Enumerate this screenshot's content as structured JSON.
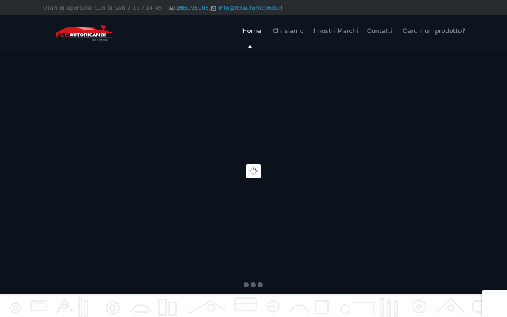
{
  "topbar": {
    "hours": "Orari di apertura: Lun al Sab 7-13 / 14.45 - 19.30",
    "phone": "0981950053",
    "email": "info@fcrautoricambi.it",
    "phone_icon": "phone-icon",
    "email_icon": "envelope-icon"
  },
  "logo": {
    "text": "FCR AUTORICAMBI",
    "tagline": "dei f.lli Guzzi"
  },
  "nav": {
    "items": [
      {
        "label": "Home"
      },
      {
        "label": "Chi siamo"
      },
      {
        "label": "I nostri Marchi"
      },
      {
        "label": "Contatti"
      },
      {
        "label": "Cerchi un prodotto?"
      }
    ],
    "active": "Home"
  },
  "slider": {
    "loader_icon": "spinner-icon",
    "bullet_count": 3
  },
  "colors": {
    "accent": "#2a9fd6",
    "brand_red": "#d5161c",
    "topbar_bg": "#272a2e",
    "hero_bg": "#0c121b"
  }
}
